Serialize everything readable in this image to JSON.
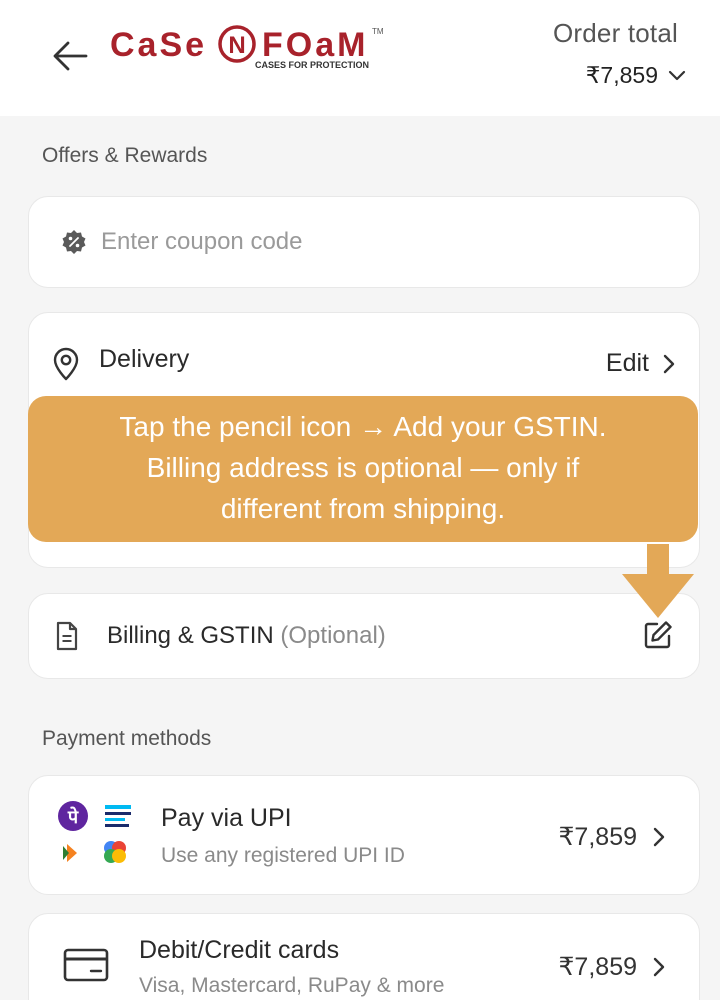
{
  "header": {
    "logo_text_left": "CaSe",
    "logo_text_mid": "N",
    "logo_text_right": "FOaM",
    "logo_tm": "TM",
    "logo_tagline": "CASES FOR PROTECTION",
    "order_total_label": "Order total",
    "order_total_amount": "₹7,859"
  },
  "offers": {
    "section_label": "Offers & Rewards",
    "coupon_placeholder": "Enter coupon code"
  },
  "delivery": {
    "title": "Delivery",
    "edit_label": "Edit"
  },
  "banner": {
    "lines": [
      "Tap the pencil icon → Add your GSTIN.",
      "Billing address is optional — only if",
      "different from shipping."
    ]
  },
  "billing": {
    "title": "Billing & GSTIN",
    "optional": "(Optional)"
  },
  "payment": {
    "section_label": "Payment methods",
    "methods": [
      {
        "title": "Pay via UPI",
        "subtitle": "Use any registered UPI ID",
        "amount": "₹7,859"
      },
      {
        "title": "Debit/Credit cards",
        "subtitle": "Visa, Mastercard, RuPay & more",
        "amount": "₹7,859"
      }
    ]
  },
  "colors": {
    "brand_red": "#a8222b",
    "banner_bg": "#e3a857",
    "phonepe_purple": "#5f259f"
  }
}
